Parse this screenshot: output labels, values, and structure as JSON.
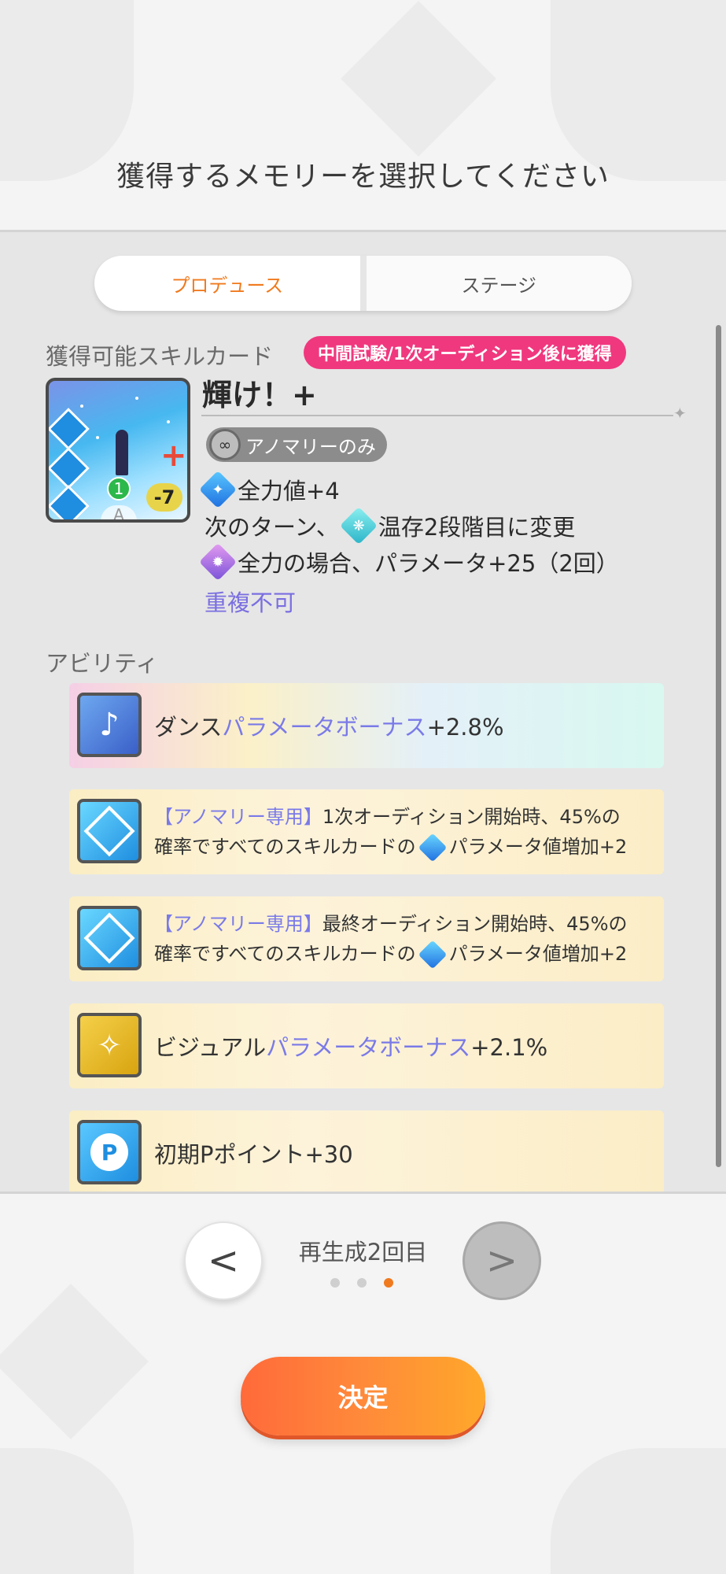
{
  "page": {
    "title": "獲得するメモリーを選択してください"
  },
  "tabs": [
    {
      "label": "プロデュース",
      "active": true
    },
    {
      "label": "ステージ",
      "active": false
    }
  ],
  "skill_card": {
    "section_label": "獲得可能スキルカード",
    "unlock_badge": "中間試験/1次オーディション後に獲得",
    "name": "輝け！+",
    "anomaly_tag": "アノマリーのみ",
    "cost": "1",
    "stamina": "-7",
    "grade": "A",
    "effects": [
      {
        "parts": [
          "全力値+4"
        ],
        "icon": "fullpower-icon"
      },
      {
        "prefix": "次のターン、",
        "parts": [
          "温存2段階目に変更"
        ],
        "icon": "conserve-icon"
      },
      {
        "parts": [
          "全力の場合、パラメータ+25（2回）"
        ],
        "icon": "fullpower-stance-icon"
      }
    ],
    "no_duplicate": "重複不可"
  },
  "abilities": {
    "section_label": "アビリティ",
    "items": [
      {
        "icon": "dance-icon",
        "prefix": "ダンス",
        "highlight": "パラメータボーナス",
        "suffix": "+2.8%"
      },
      {
        "icon": "anomaly-diamond-icon",
        "tag": "【アノマリー専用】",
        "line1": "1次オーディション開始時、45%の",
        "line2_prefix": "確率ですべてのスキルカードの",
        "line2_suffix": "パラメータ値増加+2"
      },
      {
        "icon": "anomaly-diamond-icon",
        "tag": "【アノマリー専用】",
        "line1": "最終オーディション開始時、45%の",
        "line2_prefix": "確率ですべてのスキルカードの",
        "line2_suffix": "パラメータ値増加+2"
      },
      {
        "icon": "visual-icon",
        "prefix": "ビジュアル",
        "highlight": "パラメータボーナス",
        "suffix": "+2.1%"
      },
      {
        "icon": "p-point-icon",
        "text": "初期Pポイント+30"
      }
    ]
  },
  "pager": {
    "label": "再生成2回目",
    "prev": "<",
    "next": ">",
    "dots": 3,
    "active_dot": 3
  },
  "confirm_button": "決定",
  "colors": {
    "accent_orange": "#f07a1e",
    "badge_pink": "#f0387e",
    "highlight_purple": "#7a7ae8"
  }
}
